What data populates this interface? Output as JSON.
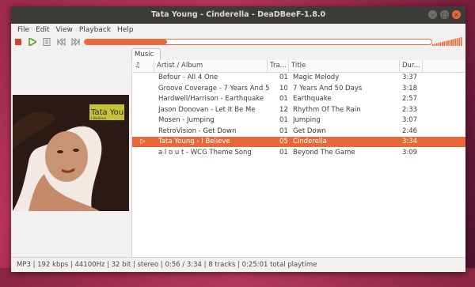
{
  "window": {
    "title": "Tata Young - Cinderella - DeaDBeeF-1.8.0"
  },
  "menu": [
    "File",
    "Edit",
    "View",
    "Playback",
    "Help"
  ],
  "playback": {
    "progress": 0.238,
    "volume": 1.0
  },
  "tab": {
    "label": "Music"
  },
  "album_art": {
    "artist_text": "Tata Young",
    "album_text": "I Believe",
    "accent": "#c8c23a"
  },
  "columns": {
    "playing": "♫",
    "artist_album": "Artist / Album",
    "track": "Tra...",
    "title": "Title",
    "duration": "Dur..."
  },
  "tracks": [
    {
      "artist_album": "Befour - All 4 One",
      "track": "01",
      "title": "Magic  Melody",
      "duration": "3:37"
    },
    {
      "artist_album": "Groove Coverage - 7 Years And 5...",
      "track": "10",
      "title": "7 Years And 50 Days",
      "duration": "3:18"
    },
    {
      "artist_album": "Hardwell/Harrison - Earthquake",
      "track": "01",
      "title": "Earthquake",
      "duration": "2:57"
    },
    {
      "artist_album": "Jason Donovan - Let It Be Me",
      "track": "12",
      "title": "Rhythm Of The Rain",
      "duration": "2:33"
    },
    {
      "artist_album": "Mosen - Jumping",
      "track": "01",
      "title": "Jumping",
      "duration": "3:07"
    },
    {
      "artist_album": "RetroVision - Get Down",
      "track": "01",
      "title": "Get Down",
      "duration": "2:46"
    },
    {
      "artist_album": "Tata Young - I Believe",
      "track": "05",
      "title": "Cinderella",
      "duration": "3:34"
    },
    {
      "artist_album": "a l o u t - WCG Theme Song",
      "track": "01",
      "title": "Beyond The Game",
      "duration": "3:09"
    }
  ],
  "playing_index": 6,
  "status": "MP3 | 192 kbps | 44100Hz | 32 bit | stereo | 0:56 / 3:34 | 8 tracks | 0:25:01 total playtime",
  "colors": {
    "accent": "#e9683a",
    "titlebar": "#3c3b37",
    "stop": "#d0442e",
    "play": "#5aa02c"
  }
}
